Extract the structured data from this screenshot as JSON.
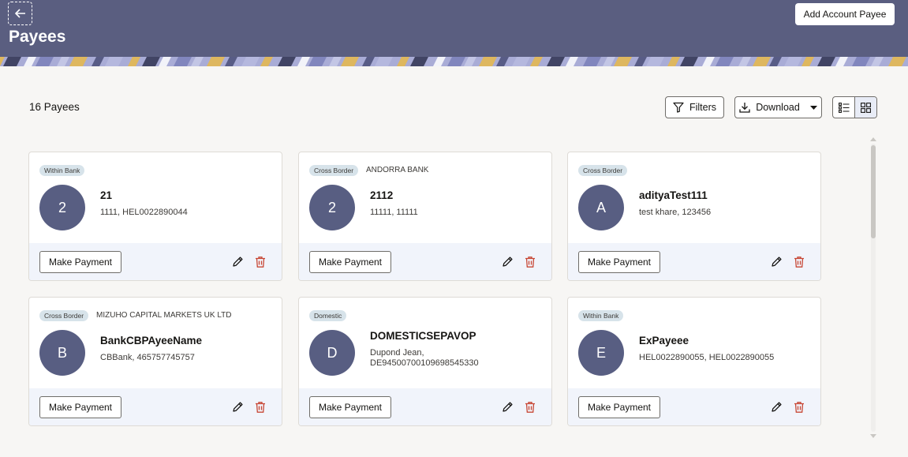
{
  "header": {
    "title": "Payees",
    "back_icon": "arrow-left-icon",
    "add_button_label": "Add Account Payee",
    "bg_color": "#5a5e80"
  },
  "toolbar": {
    "count_text": "16 Payees",
    "filters_label": "Filters",
    "download_label": "Download",
    "view_mode": "grid"
  },
  "cards": [
    {
      "badge": "Within Bank",
      "bank": "",
      "initial": "2",
      "name": "21",
      "detail": "1111, HEL0022890044",
      "pay_label": "Make Payment"
    },
    {
      "badge": "Cross Border",
      "bank": "ANDORRA BANK",
      "initial": "2",
      "name": "2112",
      "detail": "11111, 11111",
      "pay_label": "Make Payment"
    },
    {
      "badge": "Cross Border",
      "bank": "",
      "initial": "A",
      "name": "adityaTest111",
      "detail": "test khare, 123456",
      "pay_label": "Make Payment"
    },
    {
      "badge": "Cross Border",
      "bank": "MIZUHO CAPITAL MARKETS UK LTD",
      "initial": "B",
      "name": "BankCBPAyeeName",
      "detail": "CBBank, 465757745757",
      "pay_label": "Make Payment"
    },
    {
      "badge": "Domestic",
      "bank": "",
      "initial": "D",
      "name": "DOMESTICSEPAVOP",
      "detail": "Dupond Jean, DE94500700109698545330",
      "pay_label": "Make Payment"
    },
    {
      "badge": "Within Bank",
      "bank": "",
      "initial": "E",
      "name": "ExPayeee",
      "detail": "HEL0022890055, HEL0022890055",
      "pay_label": "Make Payment"
    }
  ],
  "colors": {
    "avatar": "#585e82",
    "delete_icon": "#c74634",
    "badge_bg": "#d7e3ea",
    "card_footer": "#f1f4fb"
  }
}
